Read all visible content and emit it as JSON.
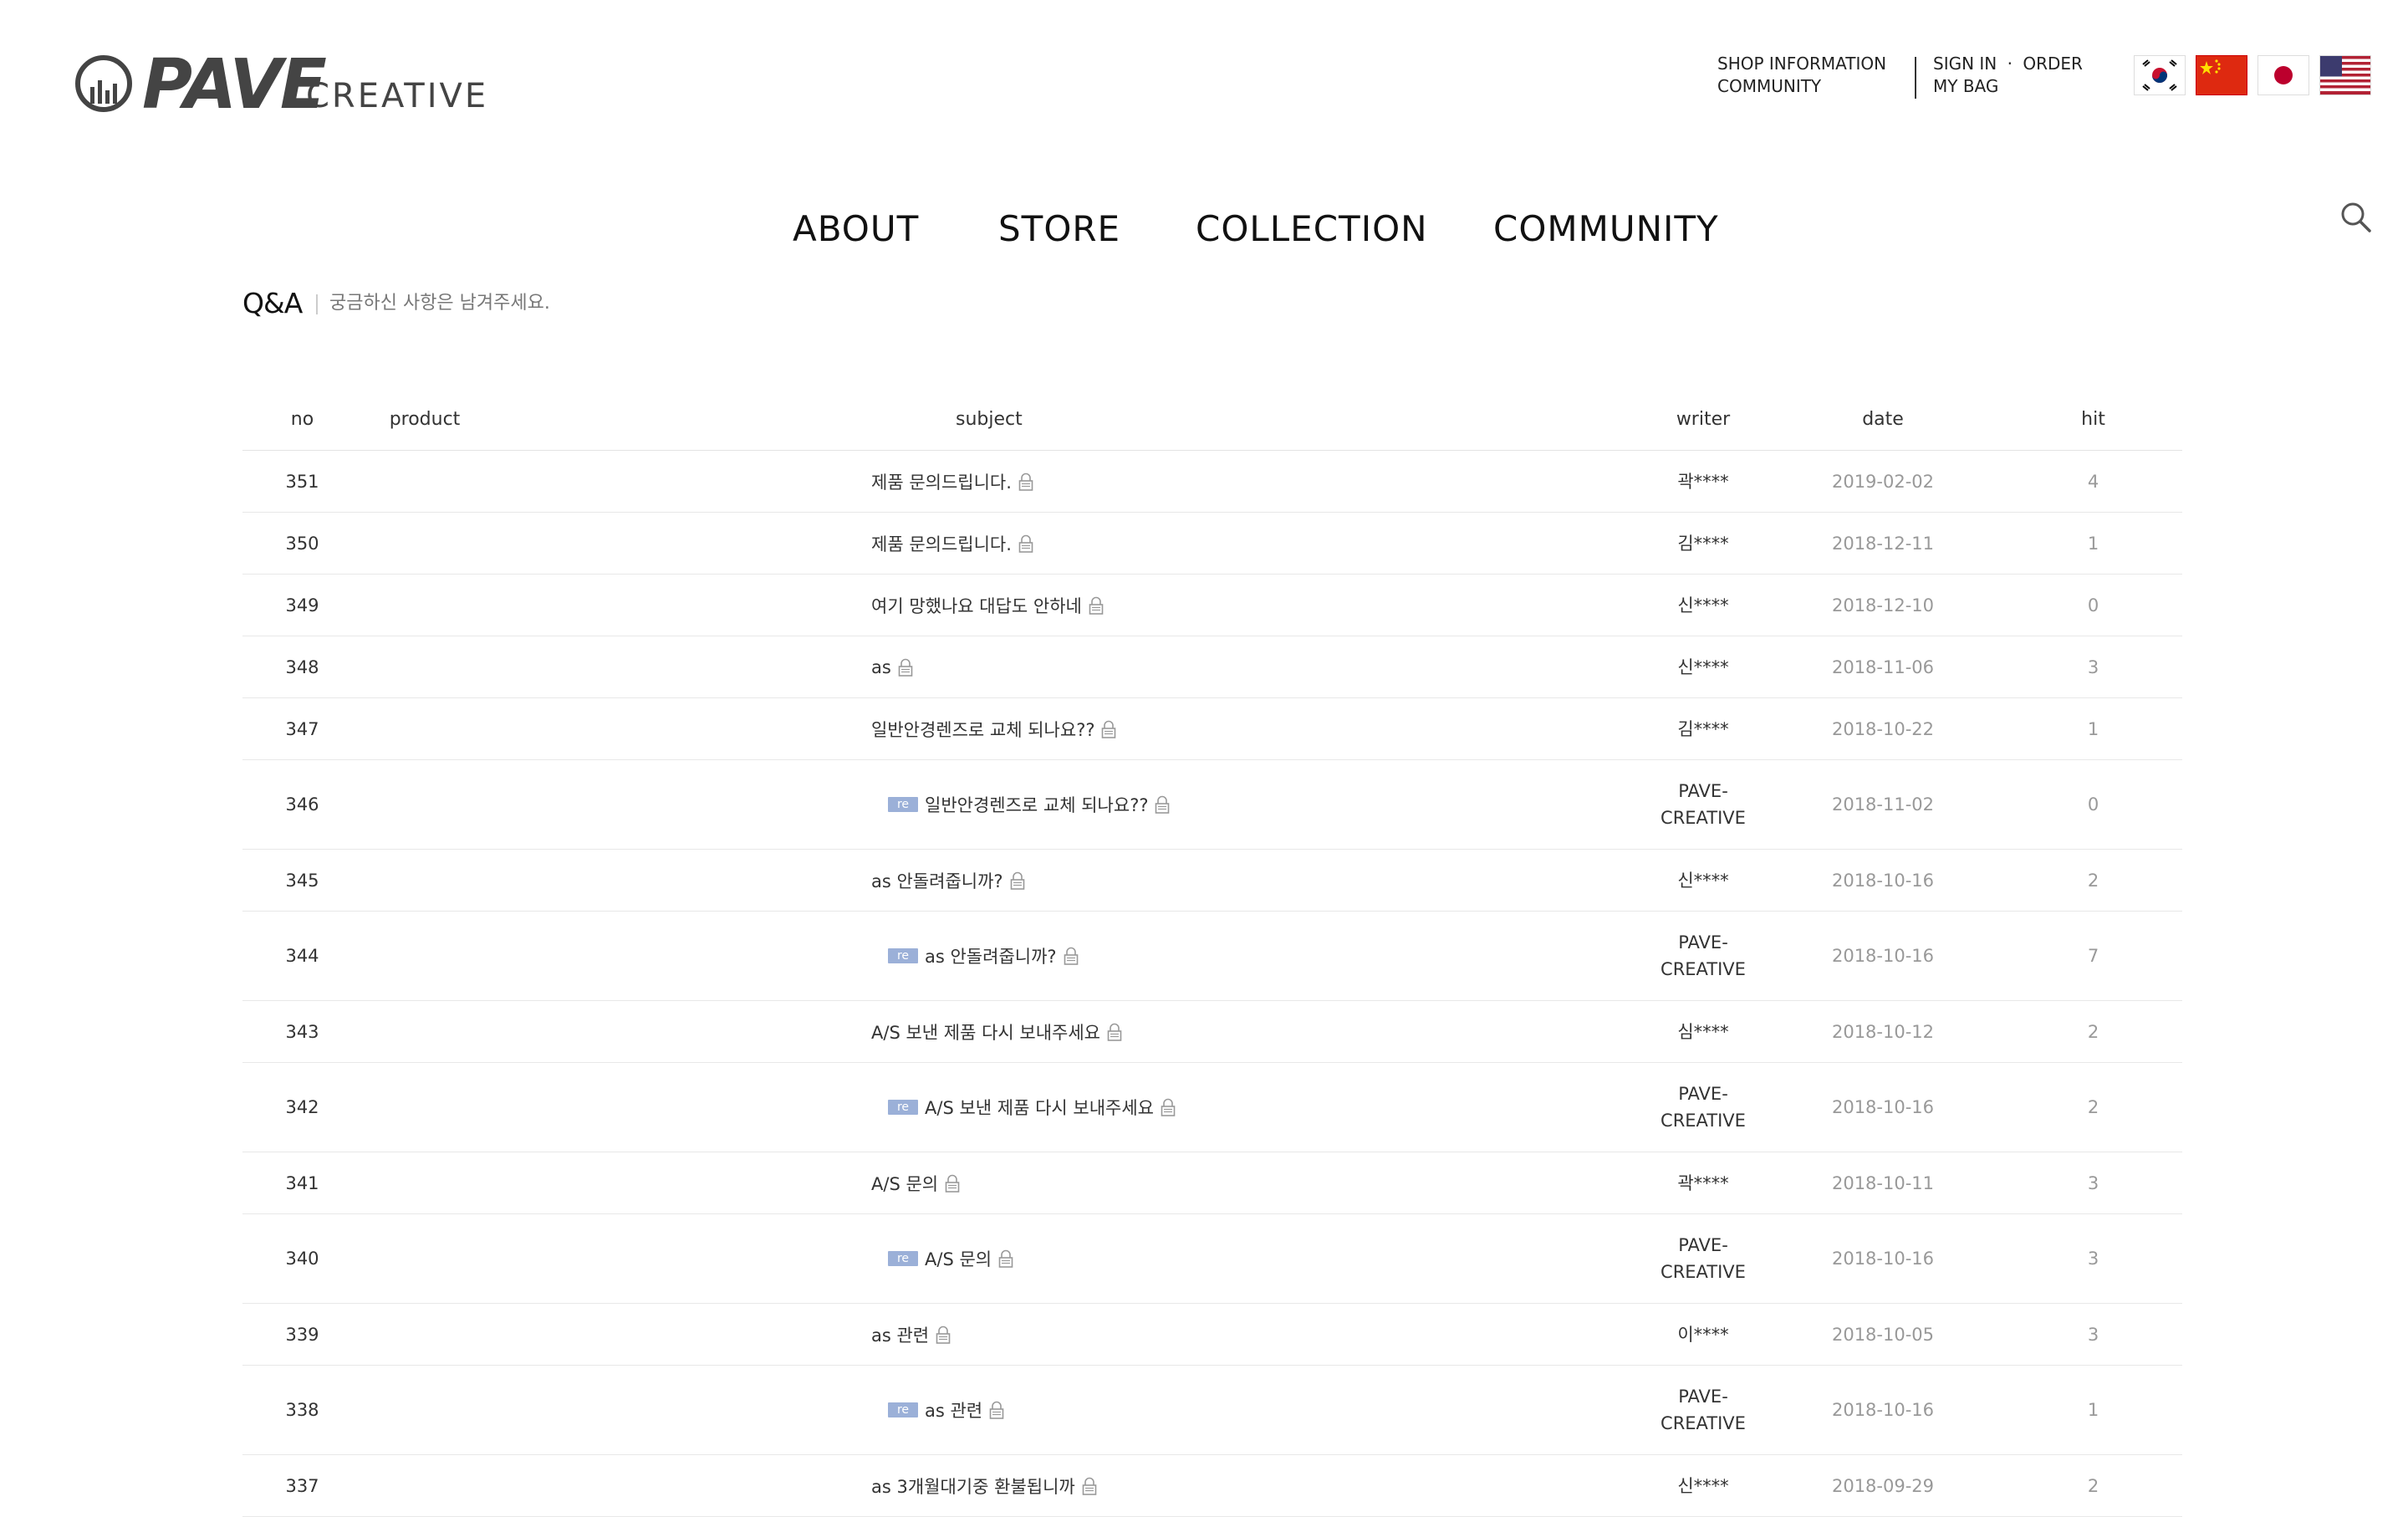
{
  "brand": {
    "wordmark": "PAVE",
    "sub": "CREATIVE"
  },
  "util": {
    "shop_info": "SHOP INFORMATION",
    "community": "COMMUNITY",
    "sign_in": "SIGN IN",
    "dot": "·",
    "order": "ORDER",
    "my_bag": "MY BAG"
  },
  "flags": [
    "korea-flag-icon",
    "china-flag-icon",
    "japan-flag-icon",
    "usa-flag-icon"
  ],
  "nav": {
    "about": "ABOUT",
    "store": "STORE",
    "collection": "COLLECTION",
    "community": "COMMUNITY"
  },
  "board": {
    "title": "Q&A",
    "desc": "궁금하신 사항은 남겨주세요."
  },
  "table": {
    "headers": {
      "no": "no",
      "product": "product",
      "subject": "subject",
      "writer": "writer",
      "date": "date",
      "hit": "hit"
    },
    "reply_badge": "re",
    "rows": [
      {
        "no": "351",
        "subject": "제품 문의드립니다.",
        "writer": "곽****",
        "writer2": "",
        "date": "2019-02-02",
        "hit": "4",
        "reply": false
      },
      {
        "no": "350",
        "subject": "제품 문의드립니다.",
        "writer": "김****",
        "writer2": "",
        "date": "2018-12-11",
        "hit": "1",
        "reply": false
      },
      {
        "no": "349",
        "subject": "여기 망했나요 대답도 안하네",
        "writer": "신****",
        "writer2": "",
        "date": "2018-12-10",
        "hit": "0",
        "reply": false
      },
      {
        "no": "348",
        "subject": "as",
        "writer": "신****",
        "writer2": "",
        "date": "2018-11-06",
        "hit": "3",
        "reply": false
      },
      {
        "no": "347",
        "subject": "일반안경렌즈로 교체 되나요??",
        "writer": "김****",
        "writer2": "",
        "date": "2018-10-22",
        "hit": "1",
        "reply": false
      },
      {
        "no": "346",
        "subject": "일반안경렌즈로 교체 되나요??",
        "writer": "PAVE-",
        "writer2": "CREATIVE",
        "date": "2018-11-02",
        "hit": "0",
        "reply": true
      },
      {
        "no": "345",
        "subject": "as 안돌려줍니까?",
        "writer": "신****",
        "writer2": "",
        "date": "2018-10-16",
        "hit": "2",
        "reply": false
      },
      {
        "no": "344",
        "subject": "as 안돌려줍니까?",
        "writer": "PAVE-",
        "writer2": "CREATIVE",
        "date": "2018-10-16",
        "hit": "7",
        "reply": true
      },
      {
        "no": "343",
        "subject": "A/S 보낸 제품 다시 보내주세요",
        "writer": "심****",
        "writer2": "",
        "date": "2018-10-12",
        "hit": "2",
        "reply": false
      },
      {
        "no": "342",
        "subject": "A/S 보낸 제품 다시 보내주세요",
        "writer": "PAVE-",
        "writer2": "CREATIVE",
        "date": "2018-10-16",
        "hit": "2",
        "reply": true
      },
      {
        "no": "341",
        "subject": "A/S 문의",
        "writer": "곽****",
        "writer2": "",
        "date": "2018-10-11",
        "hit": "3",
        "reply": false
      },
      {
        "no": "340",
        "subject": "A/S 문의",
        "writer": "PAVE-",
        "writer2": "CREATIVE",
        "date": "2018-10-16",
        "hit": "3",
        "reply": true
      },
      {
        "no": "339",
        "subject": "as 관련",
        "writer": "이****",
        "writer2": "",
        "date": "2018-10-05",
        "hit": "3",
        "reply": false
      },
      {
        "no": "338",
        "subject": "as 관련",
        "writer": "PAVE-",
        "writer2": "CREATIVE",
        "date": "2018-10-16",
        "hit": "1",
        "reply": true
      },
      {
        "no": "337",
        "subject": "as 3개월대기중 환불됩니까",
        "writer": "신****",
        "writer2": "",
        "date": "2018-09-29",
        "hit": "2",
        "reply": false
      }
    ]
  }
}
